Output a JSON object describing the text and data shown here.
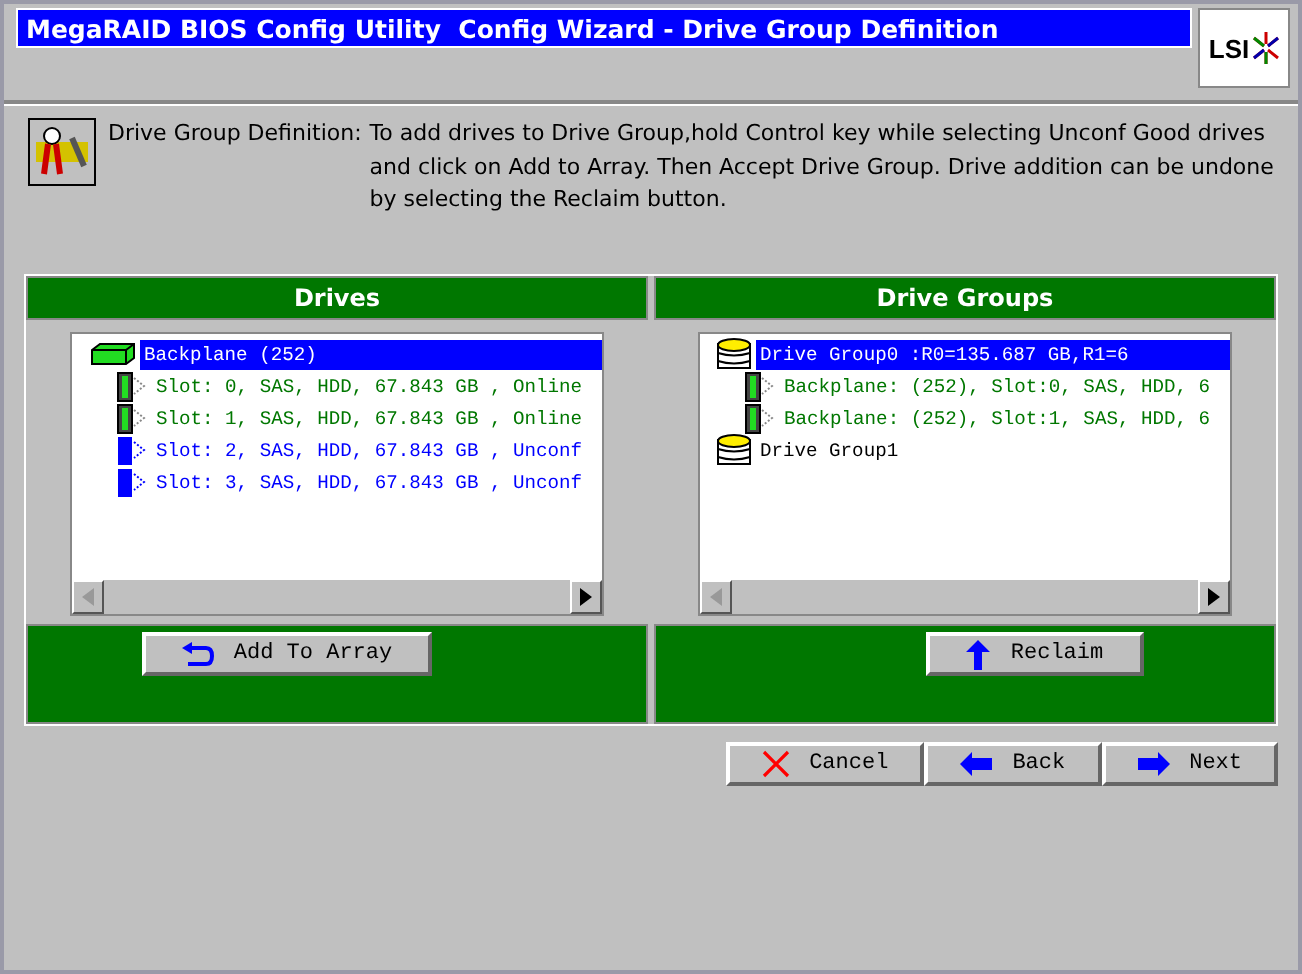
{
  "window": {
    "title": "MegaRAID BIOS Config Utility  Config Wizard - Drive Group Definition"
  },
  "logo": "LSI",
  "description": {
    "label": "Drive Group Definition:",
    "text": "To add drives to Drive Group,hold Control key while selecting Unconf Good drives and click on Add to Array. Then Accept Drive Group. Drive addition can be undone by selecting the Reclaim button."
  },
  "drives_panel": {
    "title": "Drives",
    "button": "Add To Array",
    "tree": [
      {
        "label": "Backplane (252)",
        "kind": "backplane",
        "selected": true,
        "children": [
          {
            "label": "Slot: 0, SAS, HDD, 67.843 GB , Online",
            "kind": "online",
            "selected": false
          },
          {
            "label": "Slot: 1, SAS, HDD, 67.843 GB , Online",
            "kind": "online",
            "selected": false
          },
          {
            "label": "Slot: 2, SAS, HDD, 67.843 GB , Unconf",
            "kind": "unconf",
            "selected": false
          },
          {
            "label": "Slot: 3, SAS, HDD, 67.843 GB , Unconf",
            "kind": "unconf",
            "selected": false
          }
        ]
      }
    ]
  },
  "groups_panel": {
    "title": "Drive Groups",
    "button": "Reclaim",
    "tree": [
      {
        "label": "Drive Group0 :R0=135.687 GB,R1=6",
        "kind": "group",
        "selected": true,
        "children": [
          {
            "label": "Backplane: (252), Slot:0, SAS, HDD, 6",
            "kind": "online",
            "selected": false
          },
          {
            "label": "Backplane: (252), Slot:1, SAS, HDD, 6",
            "kind": "online",
            "selected": false
          }
        ]
      },
      {
        "label": "Drive Group1",
        "kind": "group",
        "selected": false
      }
    ]
  },
  "buttons": [
    {
      "label": "Cancel",
      "kind": "cancel"
    },
    {
      "label": "Back",
      "kind": "back"
    },
    {
      "label": "Next",
      "kind": "next"
    }
  ]
}
